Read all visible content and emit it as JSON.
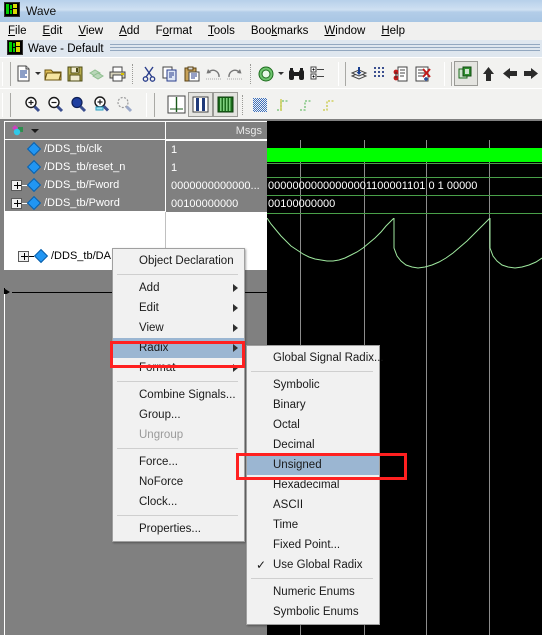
{
  "window": {
    "title": "Wave",
    "icon": "wave-app-icon",
    "dock_title": "Wave - Default"
  },
  "menubar": {
    "items": [
      {
        "label": "File",
        "mnemonic": "F"
      },
      {
        "label": "Edit",
        "mnemonic": "E"
      },
      {
        "label": "View",
        "mnemonic": "V"
      },
      {
        "label": "Add",
        "mnemonic": "A"
      },
      {
        "label": "Format",
        "mnemonic": "o"
      },
      {
        "label": "Tools",
        "mnemonic": "T"
      },
      {
        "label": "Bookmarks",
        "mnemonic": "k"
      },
      {
        "label": "Window",
        "mnemonic": "W"
      },
      {
        "label": "Help",
        "mnemonic": "H"
      }
    ]
  },
  "toolbar1": {
    "icons": [
      "new-document-icon",
      "new-document-dropdown-arrow",
      "open-folder-icon",
      "save-icon",
      "reload-icon",
      "print-icon",
      "cut-scissors-icon",
      "copy-icon",
      "paste-icon",
      "undo-icon",
      "redo-icon",
      "add-signal-icon",
      "add-signal-dropdown-arrow",
      "find-binoculars-icon",
      "properties-list-icon",
      "simulate-layers-icon",
      "grid-dots-icon",
      "waveform-compare-icon",
      "delete-report-icon",
      "copy-window-icon",
      "up-arrow-icon",
      "left-arrow-icon",
      "right-arrow-icon"
    ]
  },
  "toolbar2": {
    "icons": [
      "zoom-in-icon",
      "zoom-out-icon",
      "zoom-full-icon",
      "zoom-selection-icon",
      "zoom-region-icon",
      "cursor-single-icon",
      "cursor-pair-icon",
      "waveform-bars-icon",
      "dither-pattern-icon",
      "edge-rise-icon",
      "edge-fall-icon",
      "edge-any-icon"
    ]
  },
  "wave_pane": {
    "header": {
      "name_col_icon": "objects-colored-icon",
      "name_col_dropdown": "chevron-down-icon",
      "msgs_label": "Msgs"
    },
    "signals": [
      {
        "name": "/DDS_tb/clk",
        "value": "1",
        "expandable": false,
        "wave_value": ""
      },
      {
        "name": "/DDS_tb/reset_n",
        "value": "1",
        "expandable": false,
        "wave_value": ""
      },
      {
        "name": "/DDS_tb/Fword",
        "value": "0000000000000...",
        "expandable": true,
        "wave_value": "00000000000000001100001101 0 1 00000"
      },
      {
        "name": "/DDS_tb/Pword",
        "value": "00100000000",
        "expandable": true,
        "wave_value": "00100000000"
      }
    ],
    "analog_signal": {
      "name": "/DDS_tb/DA",
      "expandable": true
    }
  },
  "context_menu": {
    "items": [
      {
        "label": "Object Declaration",
        "submenu": false,
        "checked": false,
        "disabled": false,
        "highlighted": false
      },
      {
        "divider": true
      },
      {
        "label": "Add",
        "submenu": true,
        "checked": false,
        "disabled": false,
        "highlighted": false
      },
      {
        "label": "Edit",
        "submenu": true,
        "checked": false,
        "disabled": false,
        "highlighted": false
      },
      {
        "label": "View",
        "submenu": true,
        "checked": false,
        "disabled": false,
        "highlighted": false
      },
      {
        "label": "Radix",
        "submenu": true,
        "checked": false,
        "disabled": false,
        "highlighted": true
      },
      {
        "label": "Format",
        "submenu": true,
        "checked": false,
        "disabled": false,
        "highlighted": false
      },
      {
        "divider": true
      },
      {
        "label": "Combine Signals...",
        "submenu": false,
        "checked": false,
        "disabled": false,
        "highlighted": false
      },
      {
        "label": "Group...",
        "submenu": false,
        "checked": false,
        "disabled": false,
        "highlighted": false
      },
      {
        "label": "Ungroup",
        "submenu": false,
        "checked": false,
        "disabled": true,
        "highlighted": false
      },
      {
        "divider": true
      },
      {
        "label": "Force...",
        "submenu": false,
        "checked": false,
        "disabled": false,
        "highlighted": false
      },
      {
        "label": "NoForce",
        "submenu": false,
        "checked": false,
        "disabled": false,
        "highlighted": false
      },
      {
        "label": "Clock...",
        "submenu": false,
        "checked": false,
        "disabled": false,
        "highlighted": false
      },
      {
        "divider": true
      },
      {
        "label": "Properties...",
        "submenu": false,
        "checked": false,
        "disabled": false,
        "highlighted": false
      }
    ]
  },
  "radix_submenu": {
    "items": [
      {
        "label": "Global Signal Radix...",
        "checked": false,
        "highlighted": false
      },
      {
        "divider": true
      },
      {
        "label": "Symbolic",
        "checked": false,
        "highlighted": false
      },
      {
        "label": "Binary",
        "checked": false,
        "highlighted": false
      },
      {
        "label": "Octal",
        "checked": false,
        "highlighted": false
      },
      {
        "label": "Decimal",
        "checked": false,
        "highlighted": false
      },
      {
        "label": "Unsigned",
        "checked": false,
        "highlighted": true
      },
      {
        "label": "Hexadecimal",
        "checked": false,
        "highlighted": false
      },
      {
        "label": "ASCII",
        "checked": false,
        "highlighted": false
      },
      {
        "label": "Time",
        "checked": false,
        "highlighted": false
      },
      {
        "label": "Fixed Point...",
        "checked": false,
        "highlighted": false
      },
      {
        "label": "Use Global Radix",
        "checked": true,
        "highlighted": false
      },
      {
        "divider": true
      },
      {
        "label": "Numeric Enums",
        "checked": false,
        "highlighted": false
      },
      {
        "label": "Symbolic Enums",
        "checked": false,
        "highlighted": false
      }
    ]
  },
  "annotations": [
    {
      "name": "radix-highlight-box",
      "color": "#ff2020"
    },
    {
      "name": "unsigned-highlight-box",
      "color": "#ff2020"
    }
  ],
  "colors": {
    "wave_background": "#000000",
    "wave_trace": "#9fe89f",
    "clk_active": "#00ff00",
    "panel_gray": "#808080",
    "menu_highlight": "#9bb6d2",
    "annotation_red": "#ff2020"
  }
}
